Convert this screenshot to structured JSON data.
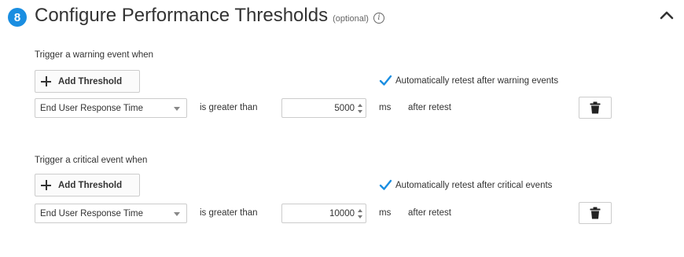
{
  "header": {
    "step_number": "8",
    "title": "Configure Performance Thresholds",
    "optional_label": "(optional)",
    "info_icon": "info-icon",
    "collapse_icon": "chevron-up-icon"
  },
  "warning": {
    "label": "Trigger a warning event when",
    "add_button_label": "Add Threshold",
    "auto_retest_label": "Automatically retest after warning events",
    "auto_retest_checked": true,
    "metric": "End User Response Time",
    "comparator": "is greater than",
    "value": "5000",
    "unit": "ms",
    "after_text": "after retest",
    "delete_icon": "trash-icon"
  },
  "critical": {
    "label": "Trigger a critical event when",
    "add_button_label": "Add Threshold",
    "auto_retest_label": "Automatically retest after critical events",
    "auto_retest_checked": true,
    "metric": "End User Response Time",
    "comparator": "is greater than",
    "value": "10000",
    "unit": "ms",
    "after_text": "after retest",
    "delete_icon": "trash-icon"
  },
  "colors": {
    "accent": "#1a8ee1",
    "text": "#333333",
    "border": "#cccccc"
  }
}
